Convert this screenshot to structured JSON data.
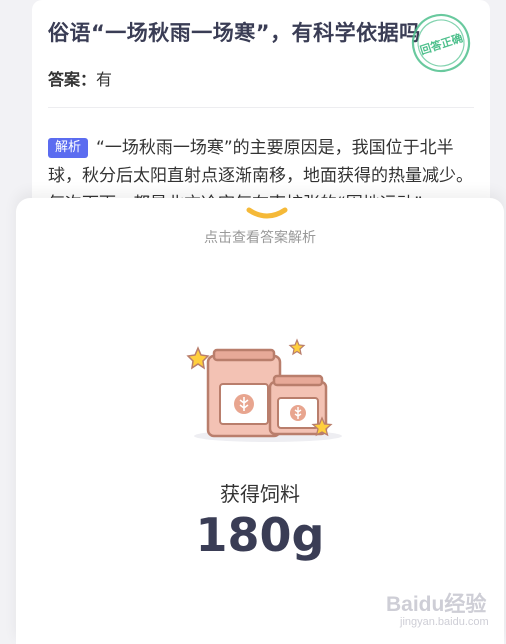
{
  "question": {
    "title": "俗语“一场秋雨一场寒”，有科学依据吗",
    "answer_label": "答案：",
    "answer_value": "有",
    "stamp_text": "回答正确",
    "explain_tag": "解析",
    "explain_text": "“一场秋雨一场寒”的主要原因是，我国位于北半球，秋分后太阳直射点逐渐南移，地面获得的热量减少。每次下雨，都是北方冷空气在南扩张的“围地运动”"
  },
  "reward": {
    "hint": "点击查看答案解析",
    "label": "获得饲料",
    "amount": "180g"
  },
  "watermark": {
    "brand": "Baidu经验",
    "url": "jingyan.baidu.com"
  },
  "colors": {
    "accent": "#5b6cf0",
    "stamp_green": "#4fc08d",
    "bag_pink": "#f3c2b4",
    "star_yellow": "#ffcf3d",
    "chevron_yellow": "#f5b938"
  }
}
